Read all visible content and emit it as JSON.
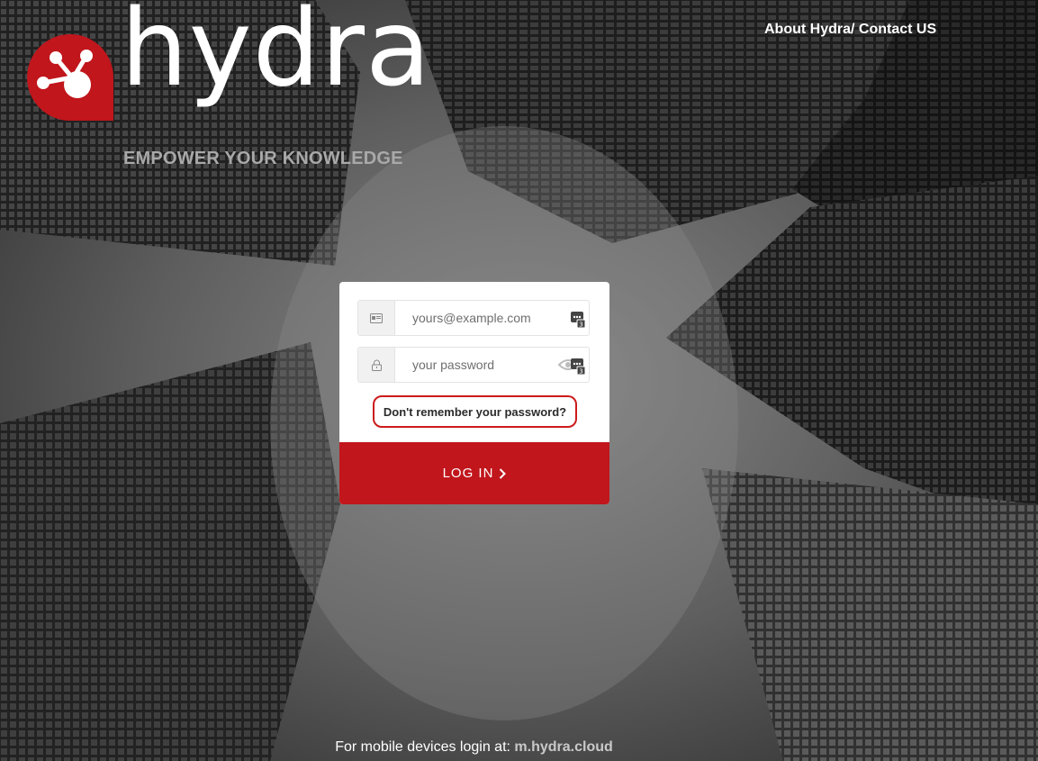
{
  "brand": {
    "name": "hydra",
    "tagline": "EMPOWER YOUR KNOWLEDGE",
    "accent_color": "#c0161c"
  },
  "topnav": {
    "about_label": "About Hydra/",
    "contact_label": " Contact US"
  },
  "login": {
    "email_placeholder": "yours@example.com",
    "password_placeholder": "your password",
    "email_icon": "id-card-icon",
    "password_icon": "lock-icon",
    "forgot_label": "Don't remember your password?",
    "login_label": "LOG IN"
  },
  "footer": {
    "text": "For mobile devices login at:",
    "link": "m.hydra.cloud"
  }
}
